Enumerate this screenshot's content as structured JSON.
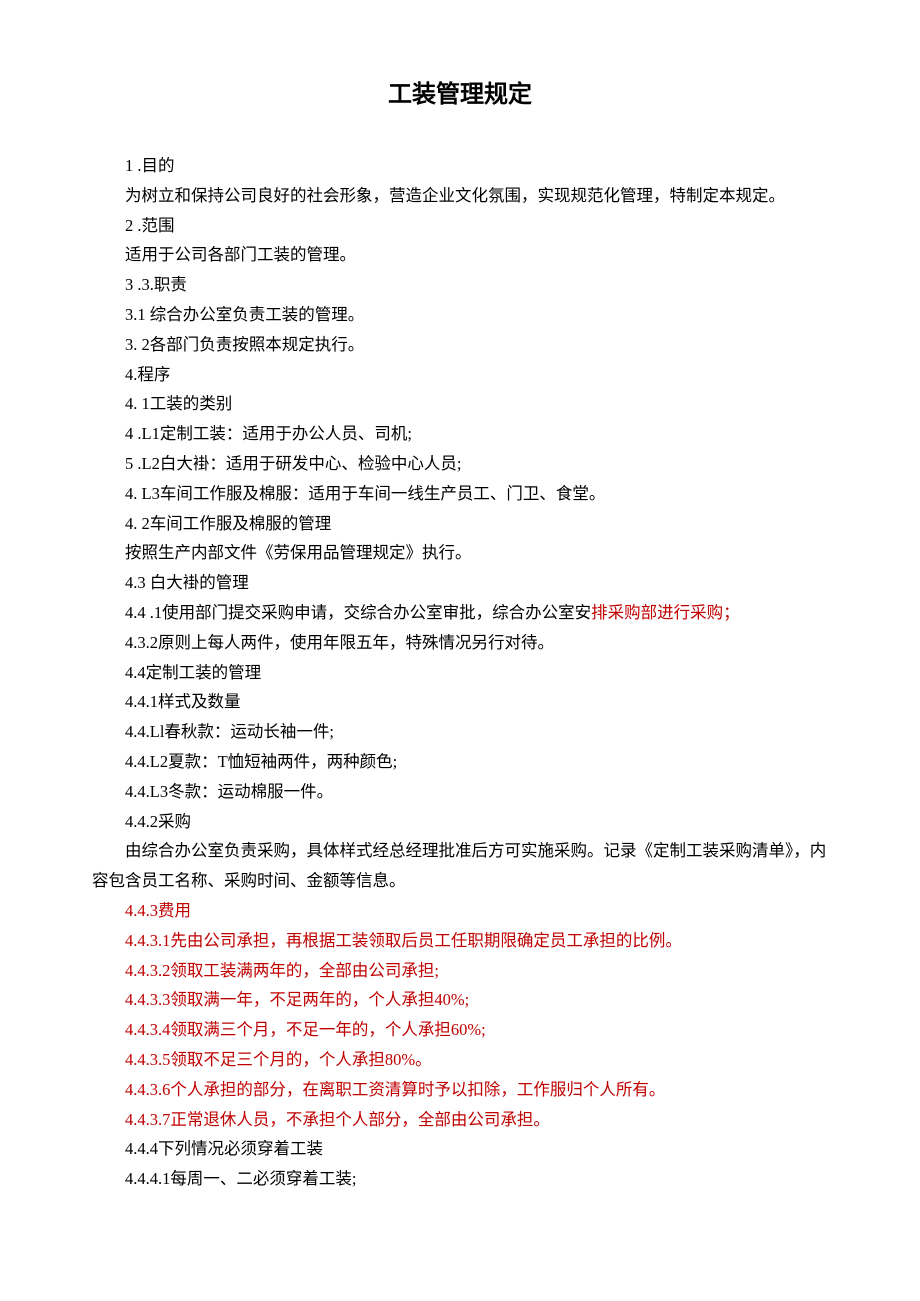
{
  "title": "工装管理规定",
  "lines": [
    {
      "text": "1 .目的",
      "indent": true,
      "red": false
    },
    {
      "text": "为树立和保持公司良好的社会形象，营造企业文化氛围，实现规范化管理，特制定本规定。",
      "indent": true,
      "red": false,
      "noIndentSecond": true
    },
    {
      "text": "2 .范围",
      "indent": true,
      "red": false
    },
    {
      "text": "适用于公司各部门工装的管理。",
      "indent": true,
      "red": false
    },
    {
      "text": "3 .3.职责",
      "indent": true,
      "red": false
    },
    {
      "text": "3.1 综合办公室负责工装的管理。",
      "indent": true,
      "red": false
    },
    {
      "text": "3. 2各部门负责按照本规定执行。",
      "indent": true,
      "red": false
    },
    {
      "text": "4.程序",
      "indent": true,
      "red": false
    },
    {
      "text": "4. 1工装的类别",
      "indent": true,
      "red": false
    },
    {
      "text": "4 .L1定制工装：适用于办公人员、司机;",
      "indent": true,
      "red": false
    },
    {
      "text": "5 .L2白大褂：适用于研发中心、检验中心人员;",
      "indent": true,
      "red": false
    },
    {
      "text": "4. L3车间工作服及棉服：适用于车间一线生产员工、门卫、食堂。",
      "indent": true,
      "red": false
    },
    {
      "text": "4. 2车间工作服及棉服的管理",
      "indent": true,
      "red": false
    },
    {
      "text": "按照生产内部文件《劳保用品管理规定》执行。",
      "indent": true,
      "red": false
    },
    {
      "text": "4.3 白大褂的管理",
      "indent": true,
      "red": false
    },
    {
      "text_parts": [
        {
          "t": "4.4 .1使用部门提交采购申请，交综合办公室审批，综合办公室安",
          "red": false
        },
        {
          "t": "排采购部进行采购；",
          "red": true
        }
      ],
      "indent": true,
      "wrap": true
    },
    {
      "text": "4.3.2原则上每人两件，使用年限五年，特殊情况另行对待。",
      "indent": true,
      "red": false
    },
    {
      "text": "4.4定制工装的管理",
      "indent": true,
      "red": false
    },
    {
      "text": "4.4.1样式及数量",
      "indent": true,
      "red": false
    },
    {
      "text": "4.4.Ll春秋款：运动长袖一件;",
      "indent": true,
      "red": false
    },
    {
      "text": "4.4.L2夏款：T恤短袖两件，两种颜色;",
      "indent": true,
      "red": false
    },
    {
      "text": "4.4.L3冬款：运动棉服一件。",
      "indent": true,
      "red": false
    },
    {
      "text": "4.4.2采购",
      "indent": true,
      "red": false
    },
    {
      "text": "由综合办公室负责采购，具体样式经总经理批准后方可实施采购。记录《定制工装采购清单》，内容包含员工名称、采购时间、金额等信息。",
      "indent": true,
      "red": false,
      "noIndentSecond": true
    },
    {
      "text": "4.4.3费用",
      "indent": true,
      "red": true
    },
    {
      "text": "4.4.3.1先由公司承担，再根据工装领取后员工任职期限确定员工承担的比例。",
      "indent": true,
      "red": true
    },
    {
      "text": "4.4.3.2领取工装满两年的，全部由公司承担;",
      "indent": true,
      "red": true
    },
    {
      "text": "4.4.3.3领取满一年，不足两年的，个人承担40%;",
      "indent": true,
      "red": true
    },
    {
      "text": "4.4.3.4领取满三个月，不足一年的，个人承担60%;",
      "indent": true,
      "red": true
    },
    {
      "text": "4.4.3.5领取不足三个月的，个人承担80%。",
      "indent": true,
      "red": true
    },
    {
      "text": "4.4.3.6个人承担的部分，在离职工资清算时予以扣除，工作服归个人所有。",
      "indent": true,
      "red": true
    },
    {
      "text": "4.4.3.7正常退休人员，不承担个人部分，全部由公司承担。",
      "indent": true,
      "red": true
    },
    {
      "text": "4.4.4下列情况必须穿着工装",
      "indent": true,
      "red": false
    },
    {
      "text": "4.4.4.1每周一、二必须穿着工装;",
      "indent": true,
      "red": false
    }
  ]
}
